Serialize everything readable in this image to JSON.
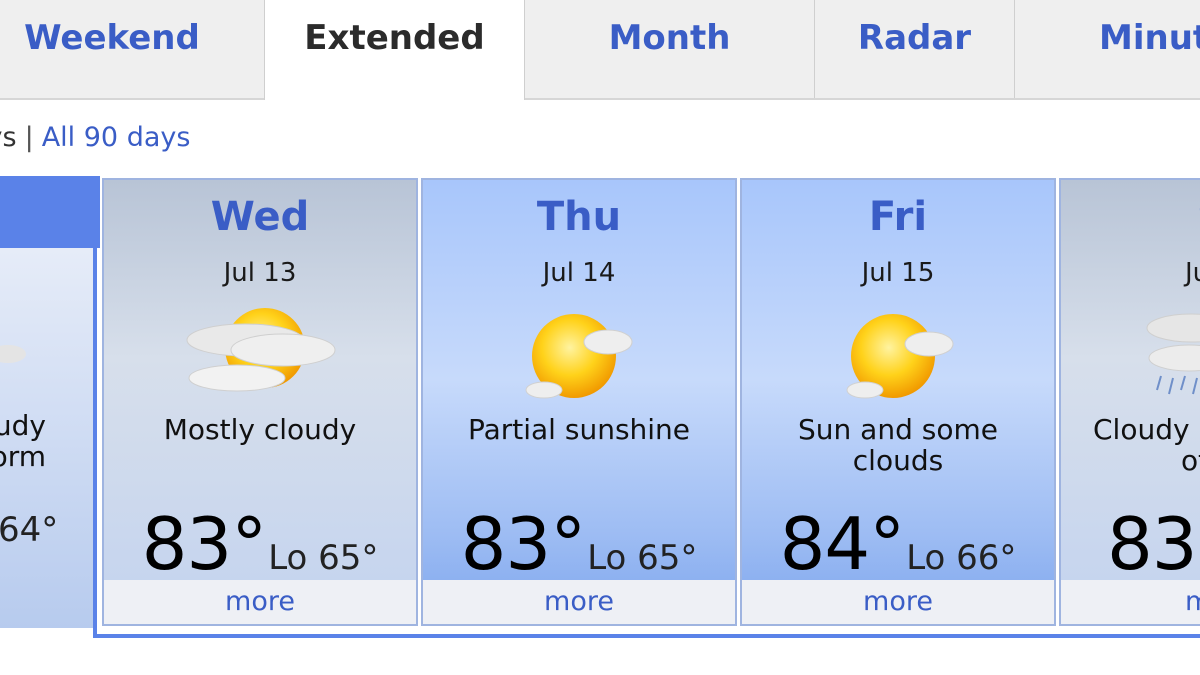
{
  "tabs": [
    {
      "label": "Weekend",
      "active": false
    },
    {
      "label": "Extended",
      "active": true
    },
    {
      "label": "Month",
      "active": false
    },
    {
      "label": "Radar",
      "active": false
    },
    {
      "label": "Minut",
      "active": false
    }
  ],
  "links": {
    "partial": "ays",
    "separator": "|",
    "all_days": "All 90 days"
  },
  "previous_day": {
    "condition_line1": "udy",
    "condition_line2": "orm",
    "lo_partial": "64°"
  },
  "days": [
    {
      "name": "Wed",
      "date": "Jul 13",
      "icon": "mostly-cloudy-icon",
      "condition": "Mostly cloudy",
      "hi": "83°",
      "lo": "Lo 65°",
      "more": "more"
    },
    {
      "name": "Thu",
      "date": "Jul 14",
      "icon": "partial-sunshine-icon",
      "condition": "Partial sunshine",
      "hi": "83°",
      "lo": "Lo 65°",
      "more": "more"
    },
    {
      "name": "Fri",
      "date": "Jul 15",
      "icon": "sun-and-clouds-icon",
      "condition": "Sun and some clouds",
      "hi": "84°",
      "lo": "Lo 66°",
      "more": "more"
    },
    {
      "name": "S",
      "date": "Ju",
      "icon": "cloudy-showers-icon",
      "condition": "Cloudy",
      "condition2": "of",
      "hi": "83",
      "lo": "",
      "more": "m"
    }
  ],
  "colors": {
    "link_blue": "#3a5dc6",
    "frame_blue": "#5a82e8",
    "tab_bg": "#efefef"
  }
}
